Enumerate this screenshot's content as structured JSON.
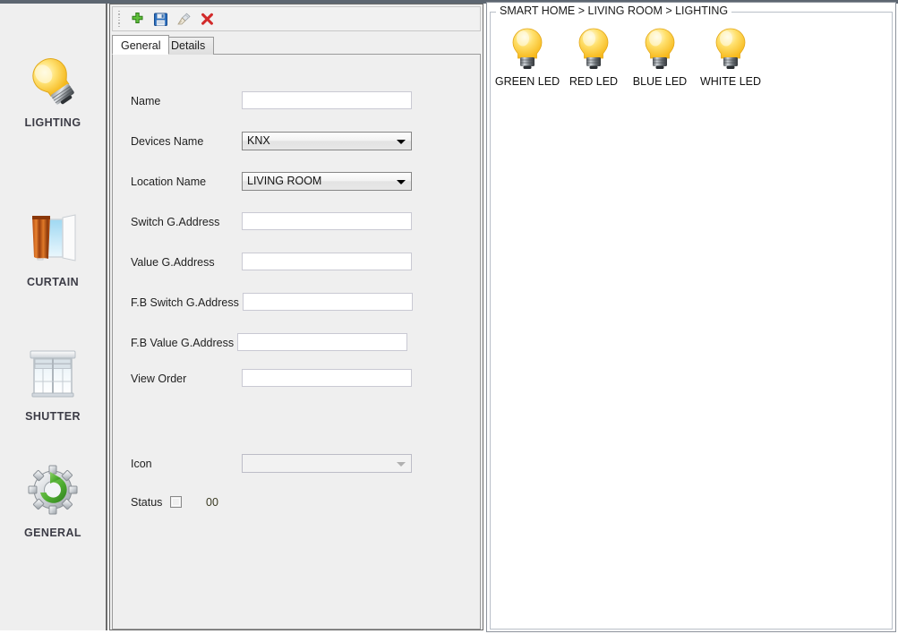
{
  "sidebar": {
    "items": [
      {
        "label": "LIGHTING",
        "icon": "lightbulb-icon"
      },
      {
        "label": "CURTAIN",
        "icon": "curtain-window-icon"
      },
      {
        "label": "SHUTTER",
        "icon": "roller-shutter-icon"
      },
      {
        "label": "GENERAL",
        "icon": "gear-refresh-icon"
      }
    ]
  },
  "toolbar": {
    "buttons": [
      {
        "name": "add-button",
        "icon": "green-plus-icon",
        "title": "Add"
      },
      {
        "name": "save-button",
        "icon": "floppy-disk-icon",
        "title": "Save"
      },
      {
        "name": "clear-button",
        "icon": "broom-icon",
        "title": "Clear"
      },
      {
        "name": "delete-button",
        "icon": "red-x-icon",
        "title": "Delete"
      }
    ]
  },
  "tabs": [
    {
      "label": "General",
      "active": true
    },
    {
      "label": "Details",
      "active": false
    }
  ],
  "form": {
    "fields": [
      {
        "label": "Name",
        "type": "text",
        "value": "",
        "placeholder": ""
      },
      {
        "label": "Devices Name",
        "type": "combo",
        "value": "KNX"
      },
      {
        "label": "Location Name",
        "type": "combo",
        "value": "LIVING ROOM"
      },
      {
        "label": "Switch G.Address",
        "type": "text",
        "value": "",
        "placeholder": ""
      },
      {
        "label": "Value G.Address",
        "type": "text",
        "value": "",
        "placeholder": ""
      },
      {
        "label": "F.B Switch G.Address",
        "type": "text",
        "value": "",
        "placeholder": ""
      },
      {
        "label": "F.B Value G.Address",
        "type": "text",
        "value": "",
        "placeholder": ""
      },
      {
        "label": "View Order",
        "type": "text",
        "value": "",
        "placeholder": ""
      }
    ],
    "icon_field": {
      "label": "Icon",
      "value": "",
      "disabled": true
    },
    "status_field": {
      "label": "Status",
      "checked": false,
      "value": "00"
    }
  },
  "right": {
    "breadcrumb": "SMART HOME > LIVING ROOM > LIGHTING",
    "devices": [
      {
        "label": "GREEN LED",
        "icon": "lightbulb-icon"
      },
      {
        "label": "RED LED",
        "icon": "lightbulb-icon"
      },
      {
        "label": "BLUE LED",
        "icon": "lightbulb-icon"
      },
      {
        "label": "WHITE LED",
        "icon": "lightbulb-icon"
      }
    ]
  },
  "colors": {
    "panel_bg": "#efefef",
    "bulb_yellow": "#ffd23f",
    "accent_green": "#56b749",
    "accent_red": "#d92b2b",
    "border_dark": "#6b6b6b"
  }
}
